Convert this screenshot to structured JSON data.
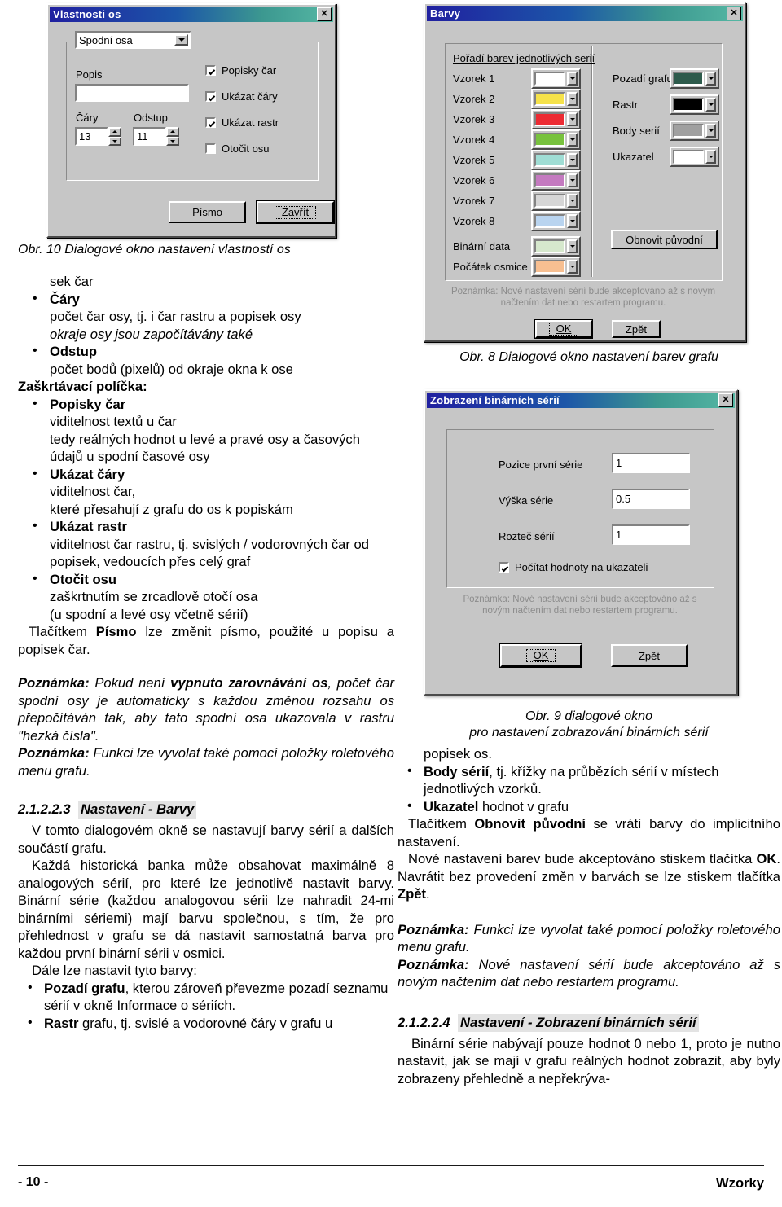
{
  "figures": {
    "axis_dialog": {
      "title": "Vlastnosti os",
      "close_label": "✕",
      "combo_value": "Spodní osa",
      "popis_label": "Popis",
      "popis_value": "",
      "cary_label": "Čáry",
      "cary_value": "13",
      "odstup_label": "Odstup",
      "odstup_value": "11",
      "checkboxes": [
        {
          "label": "Popisky čar",
          "checked": true
        },
        {
          "label": "Ukázat čáry",
          "checked": true
        },
        {
          "label": "Ukázat rastr",
          "checked": true
        },
        {
          "label": "Otočit osu",
          "checked": false
        }
      ],
      "font_button": "Písmo",
      "close_button": "Zavřít"
    },
    "colors_dialog": {
      "title": "Barvy",
      "close_label": "✕",
      "series_group_label": "Pořadí barev jednotlivých serií",
      "series": [
        {
          "label": "Vzorek 1",
          "color": "#ffffff"
        },
        {
          "label": "Vzorek 2",
          "color": "#f5e24a"
        },
        {
          "label": "Vzorek 3",
          "color": "#ec2b33"
        },
        {
          "label": "Vzorek 4",
          "color": "#78c23e"
        },
        {
          "label": "Vzorek 5",
          "color": "#9fddd4"
        },
        {
          "label": "Vzorek 6",
          "color": "#c47ac0"
        },
        {
          "label": "Vzorek 7",
          "color": "#d6d6d6"
        },
        {
          "label": "Vzorek 8",
          "color": "#b9d4ef"
        }
      ],
      "extra": [
        {
          "label": "Binární data",
          "color": "#d6e8cd"
        },
        {
          "label": "Počátek osmice",
          "color": "#f7bf91"
        }
      ],
      "right_items": [
        {
          "label": "Pozadí grafu",
          "color": "#2d5b4c"
        },
        {
          "label": "Rastr",
          "color": "#000000"
        },
        {
          "label": "Body serií",
          "color": "#a0a0a0"
        },
        {
          "label": "Ukazatel",
          "color": "#ffffff"
        }
      ],
      "restore_button": "Obnovit původní",
      "note": "Poznámka: Nové nastavení sérií bude akceptováno až s novým načtením dat nebo restartem programu.",
      "ok_button": "OK",
      "back_button": "Zpět"
    },
    "binary_dialog": {
      "title": "Zobrazení binárních sérií",
      "close_label": "✕",
      "fields": [
        {
          "label": "Pozice první série",
          "value": "1"
        },
        {
          "label": "Výška série",
          "value": "0.5"
        },
        {
          "label": "Rozteč sérií",
          "value": "1"
        }
      ],
      "checkbox": {
        "label": "Počítat hodnoty na ukazateli",
        "checked": true
      },
      "note": "Poznámka: Nové nastavení sérií bude akceptováno až s novým načtením dat nebo restartem programu.",
      "ok_button": "OK",
      "back_button": "Zpět"
    }
  },
  "captions": {
    "fig10": "Obr. 10  Dialogové okno nastavení vlastností os",
    "fig8": "Obr. 8  Dialogové okno nastavení barev grafu",
    "fig9_line1": "Obr. 9  dialogové okno",
    "fig9_line2": "pro nastavení zobrazování binárních sérií"
  },
  "left_column": {
    "continued_line": "sek čar",
    "bullets_params": [
      {
        "term": "Čáry",
        "lines": [
          "počet čar osy, tj. i čar rastru a popisek osy"
        ],
        "italic_lines": [
          "okraje osy jsou započítávány také"
        ]
      },
      {
        "term": "Odstup",
        "lines": [
          "počet bodů (pixelů) od okraje okna k ose"
        ],
        "italic_lines": []
      }
    ],
    "checkbox_heading": "Zaškrtávací políčka:",
    "bullets_checkboxes": [
      {
        "term": "Popisky čar",
        "lines": [
          "viditelnost textů u čar",
          "tedy reálných hodnot u levé a pravé osy a časových údajů u spodní časové osy"
        ]
      },
      {
        "term": "Ukázat čáry",
        "lines": [
          "viditelnost čar,",
          "které přesahují z grafu do os k popiskám"
        ]
      },
      {
        "term": "Ukázat rastr",
        "lines": [
          "viditelnost čar rastru, tj. svislých / vodorovných čar od popisek, vedoucích přes celý graf"
        ]
      },
      {
        "term": "Otočit osu",
        "lines": [
          "zaškrtnutím se zrcadlově otočí osa",
          "(u spodní a levé osy včetně sérií)"
        ]
      }
    ],
    "pismo_para_pre": "Tlačítkem ",
    "pismo_para_bold": "Písmo",
    "pismo_para_post": " lze změnit písmo, použité u popisu a popisek čar.",
    "note1_label": "Poznámka:",
    "note1_a": " Pokud není ",
    "note1_bold": "vypnuto zarovnávání os",
    "note1_b": ", počet čar spodní osy je automaticky s každou změnou rozsahu os přepočítáván tak, aby tato spodní osa ukazovala v rastru \"hezká čísla\".",
    "note2_label": "Poznámka:",
    "note2_text": " Funkci lze vyvolat také pomocí položky roletového menu grafu.",
    "section_number": "2.1.2.2.3",
    "section_title": "Nastavení - Barvy",
    "para1": "V tomto dialogovém okně se nastavují barvy sérií a dalších součástí grafu.",
    "para2": "Každá historická banka může obsahovat maximálně 8 analogových sérií, pro které lze jednotlivě nastavit barvy. Binární série (každou analogovou sérii lze nahradit 24-mi binárními sériemi) mají barvu společnou, s tím, že pro přehlednost v grafu se dá nastavit samostatná barva pro každou první binární sérii v osmici.",
    "para3": "Dále lze nastavit tyto barvy:",
    "color_bullets": [
      {
        "term": "Pozadí grafu",
        "rest": ", kterou zároveň převezme pozadí seznamu sérií v okně Informace o sériích."
      },
      {
        "term": "Rastr",
        "rest": " grafu, tj. svislé a vodorovné čáry v grafu u"
      }
    ]
  },
  "right_column": {
    "continued_line": "popisek os.",
    "color_bullets": [
      {
        "term": "Body sérií",
        "rest": ", tj. křížky na průbězích sérií v místech jednotlivých vzorků."
      },
      {
        "term": "Ukazatel",
        "rest": " hodnot v grafu"
      }
    ],
    "obnovit_pre": "Tlačítkem ",
    "obnovit_bold": "Obnovit původní",
    "obnovit_post": " se vrátí barvy do implicitního nastavení.",
    "ok_para_a": "Nové nastavení barev bude akceptováno stiskem tlačítka ",
    "ok_para_bold1": "OK",
    "ok_para_b": ". Navrátit bez provedení změn v barvách se lze stiskem tlačítka ",
    "ok_para_bold2": "Zpět",
    "ok_para_c": ".",
    "note1_label": "Poznámka:",
    "note1_text": " Funkci lze vyvolat také pomocí položky roletového menu grafu.",
    "note2_label": "Poznámka:",
    "note2_text": " Nové nastavení sérií bude akceptováno až s novým načtením dat nebo restartem programu.",
    "section_number": "2.1.2.2.4",
    "section_title": "Nastavení - Zobrazení binárních sérií",
    "para1": "Binární série nabývají pouze hodnot 0 nebo 1, proto je nutno nastavit, jak se mají v grafu reálných hodnot zobrazit, aby byly zobrazeny přehledně a nepřekrýva-"
  },
  "footer": {
    "page_number": "- 10 -",
    "doc_name": "Wzorky"
  }
}
